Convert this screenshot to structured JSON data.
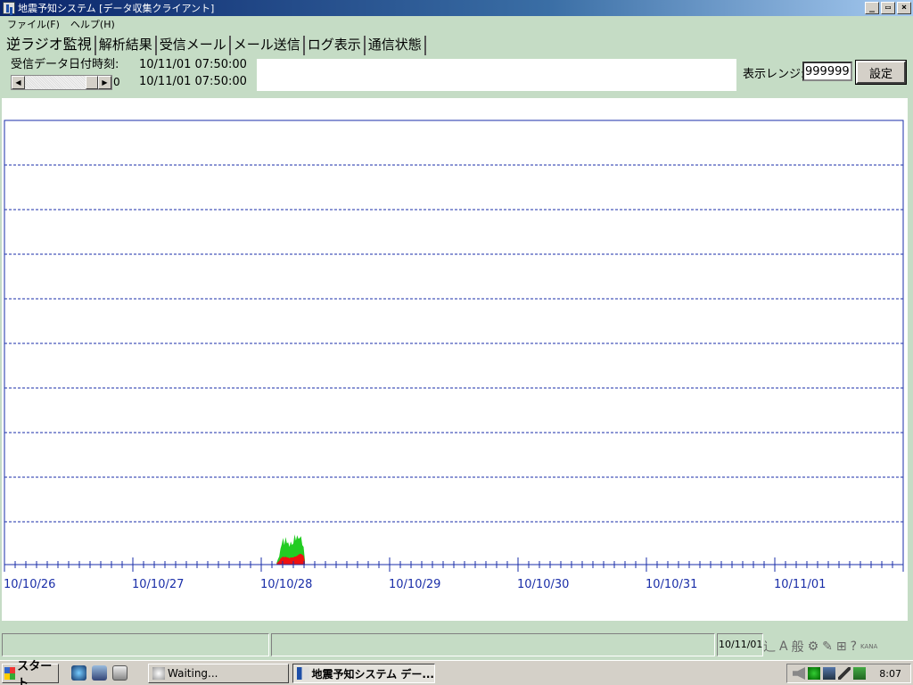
{
  "window": {
    "title": "地震予知システム [データ収集クライアント]",
    "buttons": [
      "_",
      "▭",
      "×"
    ]
  },
  "menu": [
    {
      "label": "ファイル(F)"
    },
    {
      "label": "ヘルプ(H)"
    }
  ],
  "tabs": [
    {
      "label": "逆ラジオ監視",
      "active": true
    },
    {
      "label": "解析結果",
      "active": false
    },
    {
      "label": "受信メール",
      "active": false
    },
    {
      "label": "メール送信",
      "active": false
    },
    {
      "label": "ログ表示",
      "active": false
    },
    {
      "label": "通信状態",
      "active": false
    }
  ],
  "receive": {
    "label": "受信データ日付時刻:",
    "datetime_start": "10/11/01  07:50:00",
    "datetime_end": "10/11/01  07:50:00",
    "scroll_value": "0"
  },
  "range": {
    "label": "表示レンジ:",
    "value": "999999",
    "set_label": "設定"
  },
  "chart_data": {
    "type": "area",
    "x_tick_labels": [
      "10/10/26",
      "10/10/27",
      "10/10/28",
      "10/10/29",
      "10/10/30",
      "10/10/31",
      "10/11/01"
    ],
    "gridlines_y": 9,
    "ticks_per_day": 12,
    "series": [
      {
        "color": "#22cc22",
        "x": [
          2.12,
          2.13,
          2.14,
          2.15,
          2.16,
          2.17,
          2.18,
          2.19,
          2.2,
          2.21,
          2.22,
          2.23,
          2.24,
          2.25,
          2.26,
          2.27,
          2.28,
          2.29,
          2.3,
          2.31,
          2.32,
          2.33,
          2.34
        ],
        "values": [
          0.2,
          0.6,
          0.9,
          1.8,
          2.3,
          3.0,
          2.2,
          3.1,
          2.4,
          2.5,
          2.0,
          2.6,
          2.2,
          2.4,
          3.4,
          2.7,
          3.3,
          2.9,
          3.0,
          3.2,
          2.2,
          2.0,
          0.5
        ]
      },
      {
        "color": "#ee1111",
        "x": [
          2.12,
          2.13,
          2.14,
          2.15,
          2.16,
          2.17,
          2.18,
          2.19,
          2.2,
          2.21,
          2.22,
          2.23,
          2.24,
          2.25,
          2.26,
          2.27,
          2.28,
          2.29,
          2.3,
          2.31,
          2.32,
          2.33,
          2.34
        ],
        "values": [
          0.1,
          0.3,
          0.4,
          0.7,
          0.8,
          0.9,
          0.8,
          0.9,
          0.8,
          0.8,
          0.7,
          0.8,
          0.8,
          0.8,
          0.9,
          0.9,
          1.0,
          1.1,
          1.2,
          1.2,
          1.1,
          1.0,
          0.3
        ]
      }
    ],
    "y_max": 50,
    "axis_color": "#1a2ea8",
    "label_color": "#1a2ea8"
  },
  "status": {
    "date_text": "10/11/01"
  },
  "ime": {
    "items": [
      "辶",
      "A",
      "般",
      "⚙",
      "✎",
      "⊞",
      "?",
      "KANA"
    ]
  },
  "taskbar": {
    "start_label": "スタート",
    "tasks": [
      {
        "label": "Waiting...",
        "active": false
      },
      {
        "label": "地震予知システム デー...",
        "active": true
      }
    ],
    "clock": "8:07"
  }
}
